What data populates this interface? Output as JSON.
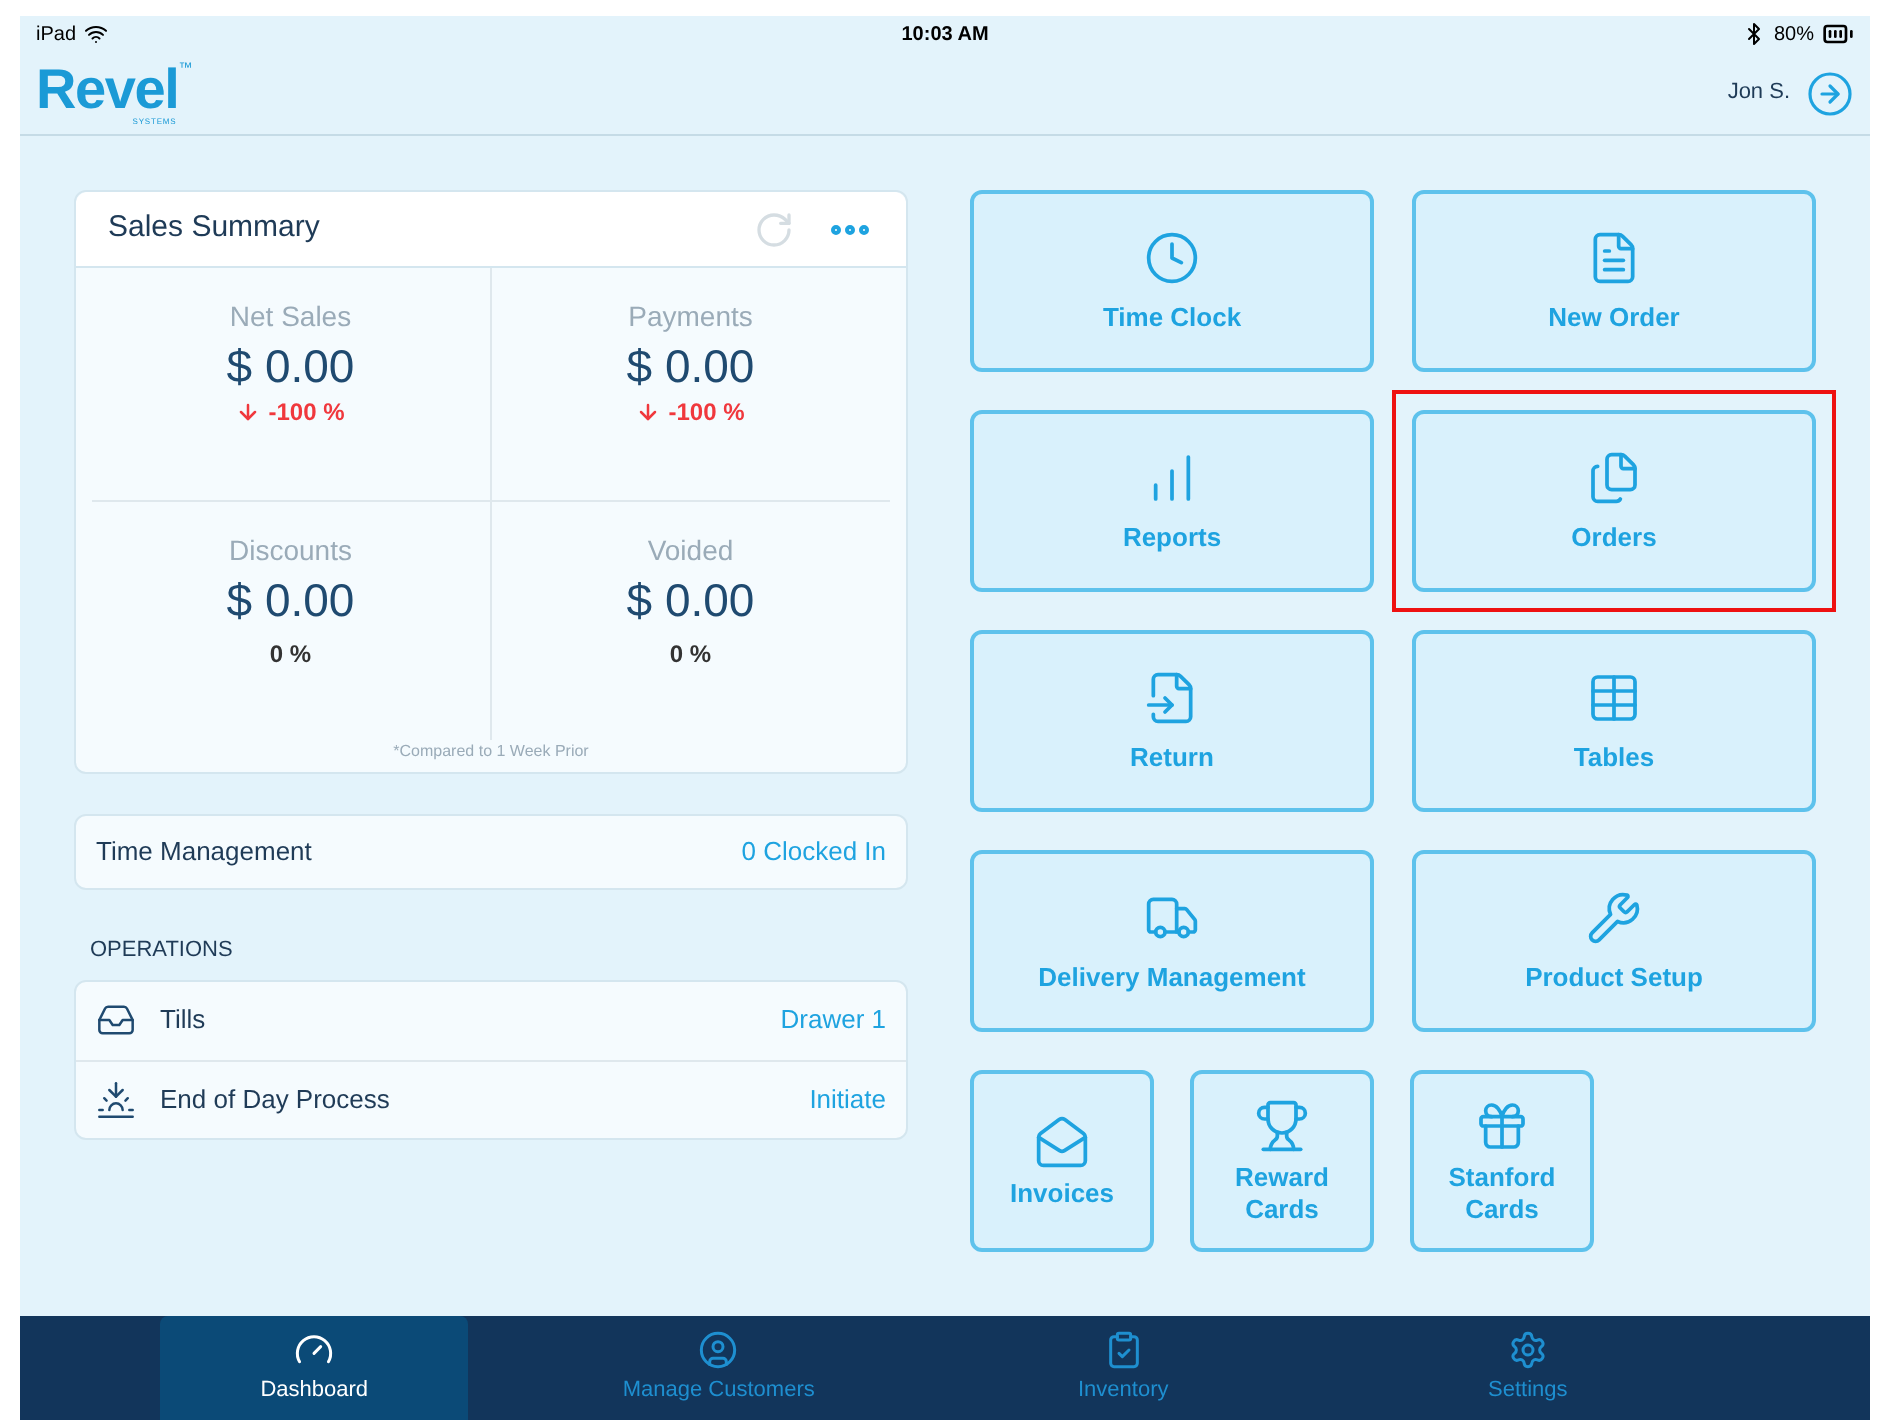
{
  "status_bar": {
    "device": "iPad",
    "time": "10:03 AM",
    "battery": "80%"
  },
  "header": {
    "logo": "Revel",
    "logo_sub": "SYSTEMS",
    "logo_tm": "™",
    "user": "Jon S."
  },
  "sales_summary": {
    "title": "Sales Summary",
    "footnote": "*Compared to 1 Week Prior",
    "metrics": [
      {
        "label": "Net Sales",
        "value": "$ 0.00",
        "change": "-100 %",
        "kind": "decrease"
      },
      {
        "label": "Payments",
        "value": "$ 0.00",
        "change": "-100 %",
        "kind": "decrease"
      },
      {
        "label": "Discounts",
        "value": "$ 0.00",
        "change": "0 %",
        "kind": "neutral"
      },
      {
        "label": "Voided",
        "value": "$ 0.00",
        "change": "0 %",
        "kind": "neutral"
      }
    ]
  },
  "time_management": {
    "label": "Time Management",
    "value": "0 Clocked In"
  },
  "operations": {
    "title": "OPERATIONS",
    "rows": [
      {
        "label": "Tills",
        "action": "Drawer 1"
      },
      {
        "label": "End of Day Process",
        "action": "Initiate"
      }
    ]
  },
  "tiles": [
    {
      "label": "Time Clock",
      "kind": "large",
      "highlighted": false
    },
    {
      "label": "New Order",
      "kind": "large",
      "highlighted": false
    },
    {
      "label": "Reports",
      "kind": "large",
      "highlighted": false
    },
    {
      "label": "Orders",
      "kind": "large",
      "highlighted": true
    },
    {
      "label": "Return",
      "kind": "large",
      "highlighted": false
    },
    {
      "label": "Tables",
      "kind": "large",
      "highlighted": false
    },
    {
      "label": "Delivery Management",
      "kind": "large",
      "highlighted": false
    },
    {
      "label": "Product Setup",
      "kind": "large",
      "highlighted": false
    },
    {
      "label": "Invoices",
      "kind": "small",
      "highlighted": false
    },
    {
      "label": "Reward Cards",
      "kind": "small",
      "highlighted": false
    },
    {
      "label": "Stanford Cards",
      "kind": "small",
      "highlighted": false
    }
  ],
  "nav": [
    {
      "label": "Dashboard",
      "selected": true
    },
    {
      "label": "Manage Customers",
      "selected": false
    },
    {
      "label": "Inventory",
      "selected": false
    },
    {
      "label": "Settings",
      "selected": false
    }
  ]
}
